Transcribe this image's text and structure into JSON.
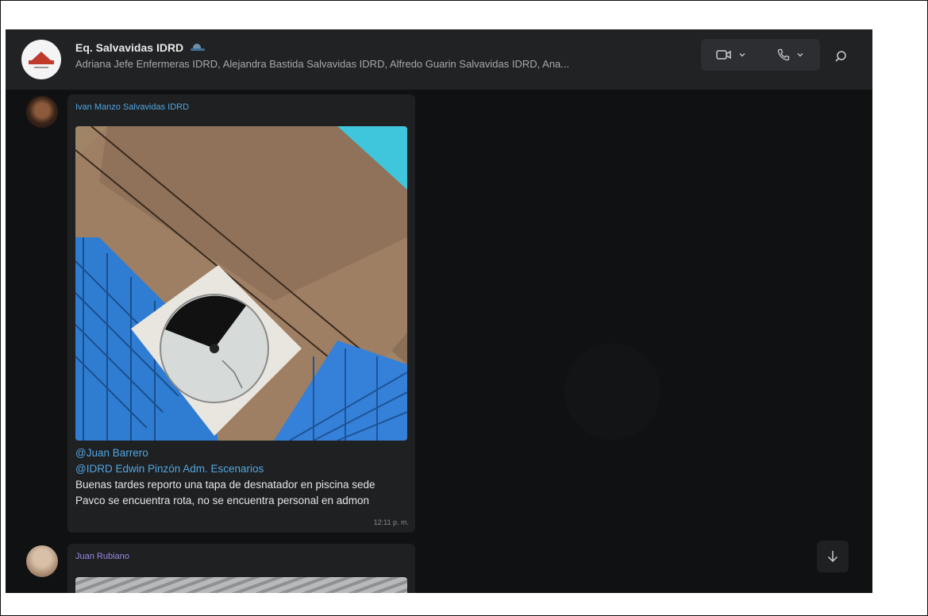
{
  "header": {
    "title": "Eq. Salvavidas IDRD",
    "members": "Adriana Jefe Enfermeras IDRD, Alejandra Bastida Salvavidas IDRD, Alfredo Guarin Salvavidas IDRD, Ana...",
    "video_call_icon": "video-camera-icon",
    "voice_call_icon": "phone-icon",
    "search_icon": "search-icon"
  },
  "messages": [
    {
      "sender": "Ivan Manzo Salvavidas IDRD",
      "sender_color": "#53a6e0",
      "image": "photo of broken pool skimmer cover",
      "mention_1": "@Juan Barrero",
      "mention_2": "@IDRD Edwin Pinzón Adm. Escenarios",
      "text": "Buenas tardes reporto una tapa de desnatador en piscina sede Pavco se encuentra rota, no se encuentra personal en admon",
      "time": "12:11 p. m."
    },
    {
      "sender": "Juan Rubiano",
      "sender_color": "#9b88e8"
    }
  ],
  "scroll_down_icon": "arrow-down-icon",
  "colors": {
    "background": "#101113",
    "header": "#202224",
    "bubble": "#1e2022",
    "mention": "#53a6e0"
  }
}
